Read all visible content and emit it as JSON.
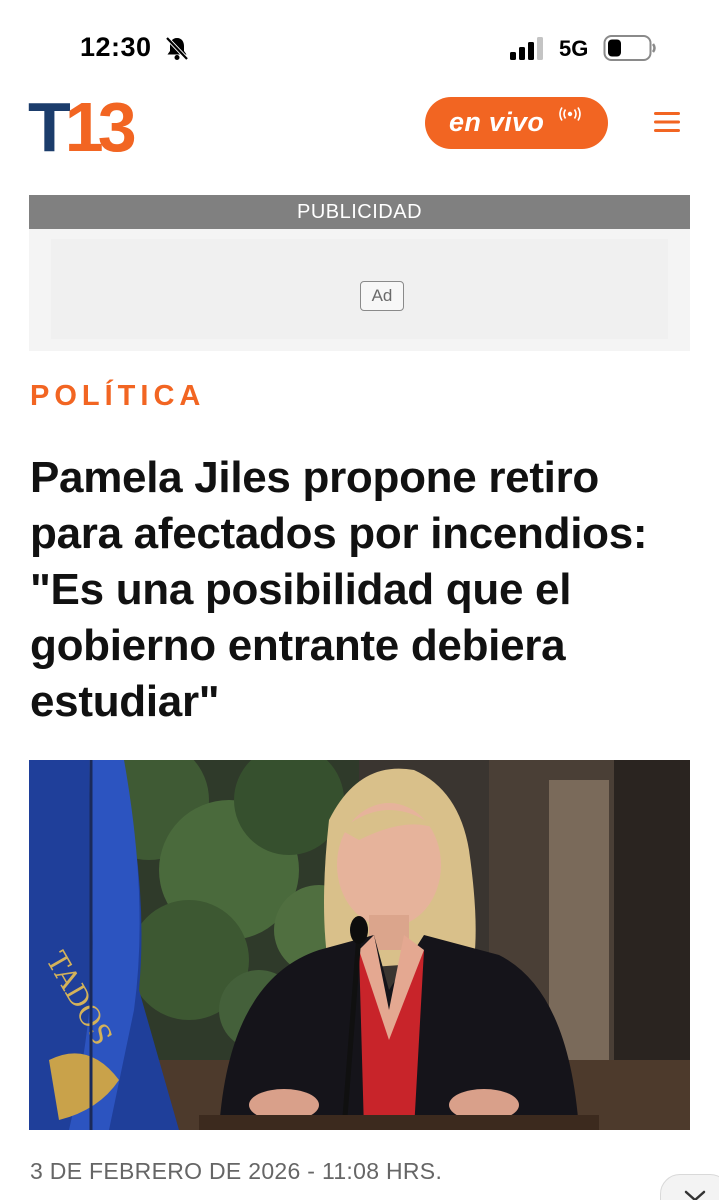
{
  "status_bar": {
    "time": "12:30",
    "network": "5G"
  },
  "header": {
    "logo_t": "T",
    "logo_num": "13",
    "live_label": "en vivo"
  },
  "ad": {
    "strip_label": "PUBLICIDAD",
    "badge": "Ad"
  },
  "article": {
    "category": "POLÍTICA",
    "headline": "Pamela Jiles propone retiro para afectados por incendios: \"Es una posibilidad que el gobierno entrante debiera estudiar\"",
    "date": "3 DE FEBRERO DE 2026 - 11:08 HRS."
  },
  "colors": {
    "brand_orange": "#f26522",
    "brand_navy": "#1b3c6b"
  }
}
